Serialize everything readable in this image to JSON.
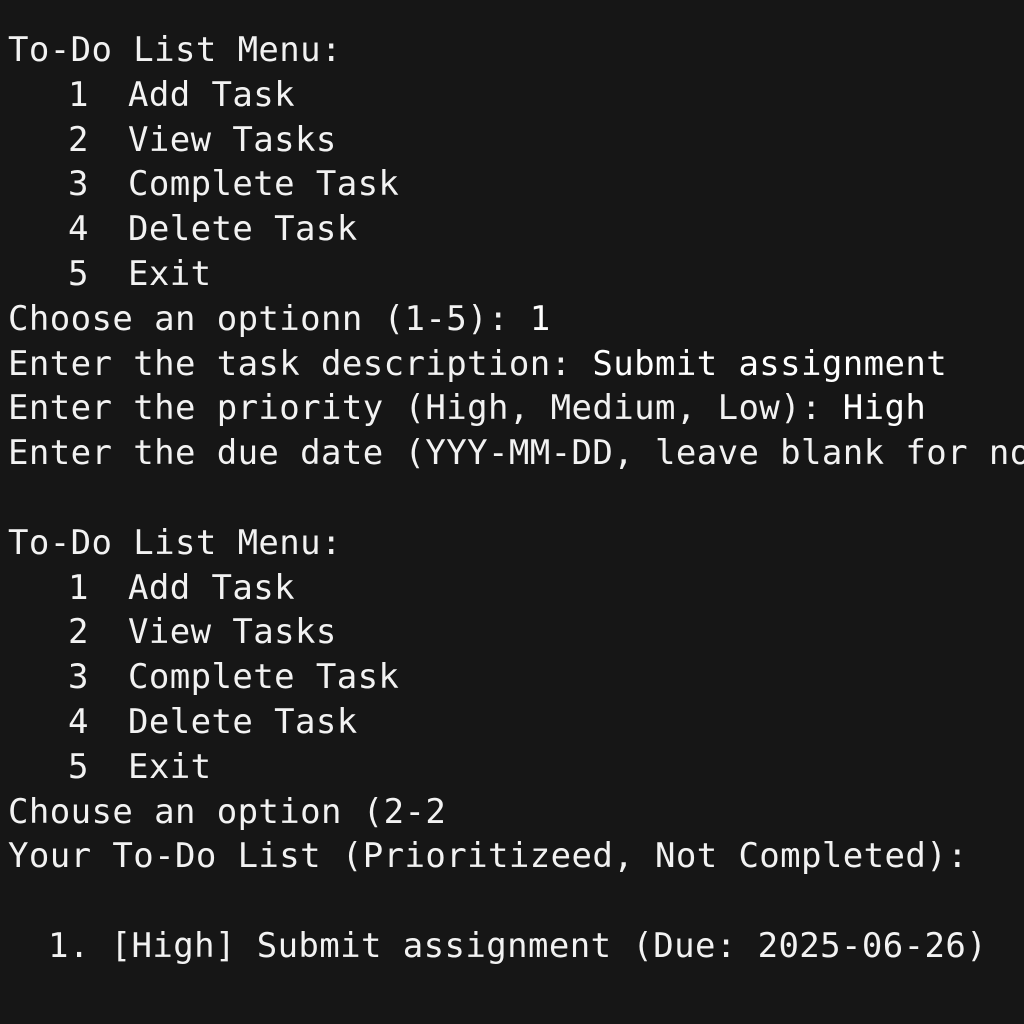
{
  "menu1": {
    "title": "To-Do List Menu:",
    "items": [
      {
        "num": "1",
        "label": "Add Task"
      },
      {
        "num": "2",
        "label": "View Tasks"
      },
      {
        "num": "3",
        "label": "Complete Task"
      },
      {
        "num": "4",
        "label": "Delete Task"
      },
      {
        "num": "5",
        "label": "Exit"
      }
    ],
    "prompt": "Choose an optionn (1-5):",
    "input": " 1"
  },
  "add_task": {
    "desc_prompt": "Enter the task description:",
    "desc_input": " Submit assignment",
    "priority_prompt": "Enter the priority (High, Medium, Low):",
    "priority_input": " High",
    "due_prompt": "Enter the due date (YYY-MM-DD, leave blank for nond"
  },
  "menu2": {
    "title": "To-Do List Menu:",
    "items": [
      {
        "num": "1",
        "label": "Add Task"
      },
      {
        "num": "2",
        "label": "View Tasks"
      },
      {
        "num": "3",
        "label": "Complete Task"
      },
      {
        "num": "4",
        "label": "Delete Task"
      },
      {
        "num": "5",
        "label": "Exit"
      }
    ],
    "prompt": "Chouse an option (2-2"
  },
  "list": {
    "heading": "Your To-Do List (Prioritizeed, Not Completed):",
    "tasks": [
      {
        "text": "1. [High] Submit assignment (Due: 2025-06-26)"
      }
    ]
  }
}
